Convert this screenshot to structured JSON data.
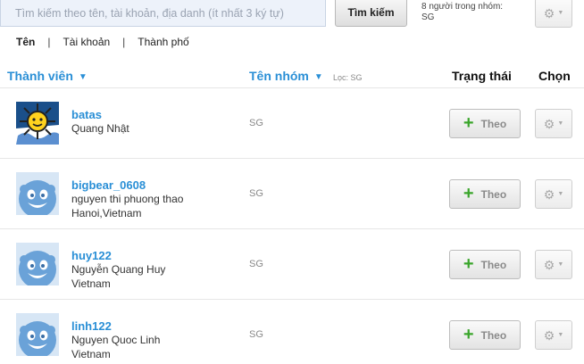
{
  "search": {
    "placeholder": "Tìm kiếm theo tên, tài khoản, địa danh (ít nhất 3 ký tự)",
    "button_label": "Tìm kiếm",
    "group_count_line1": "8 người trong nhóm:",
    "group_count_line2": "SG"
  },
  "icons": {
    "gear": "gear-icon",
    "caret": "caret-down-icon",
    "plus": "plus-icon"
  },
  "filters": [
    {
      "label": "Tên",
      "active": true
    },
    {
      "label": "Tài khoản",
      "active": false
    },
    {
      "label": "Thành phố",
      "active": false
    }
  ],
  "filter_sep": "|",
  "header": {
    "member": "Thành viên",
    "group_name": "Tên nhóm",
    "filter_note": "Lọc: SG",
    "status": "Trạng thái",
    "select": "Chọn",
    "sort_arrow": "▼"
  },
  "colors": {
    "link": "#2a8fd6",
    "follow_plus": "#3aa52b"
  },
  "members": [
    {
      "username": "batas",
      "lines": [
        "Quang Nhật"
      ],
      "group": "SG",
      "avatar": "sun-avatar",
      "follow_label": "Theo"
    },
    {
      "username": "bigbear_0608",
      "lines": [
        "nguyen thi phuong thao",
        "Hanoi,Vietnam"
      ],
      "group": "SG",
      "avatar": "default-face-avatar",
      "follow_label": "Theo"
    },
    {
      "username": "huy122",
      "lines": [
        "Nguyễn Quang Huy",
        "Vietnam"
      ],
      "group": "SG",
      "avatar": "default-face-avatar",
      "follow_label": "Theo"
    },
    {
      "username": "linh122",
      "lines": [
        "Nguyen Quoc Linh",
        "Vietnam"
      ],
      "group": "SG",
      "avatar": "default-face-avatar",
      "follow_label": "Theo"
    }
  ]
}
